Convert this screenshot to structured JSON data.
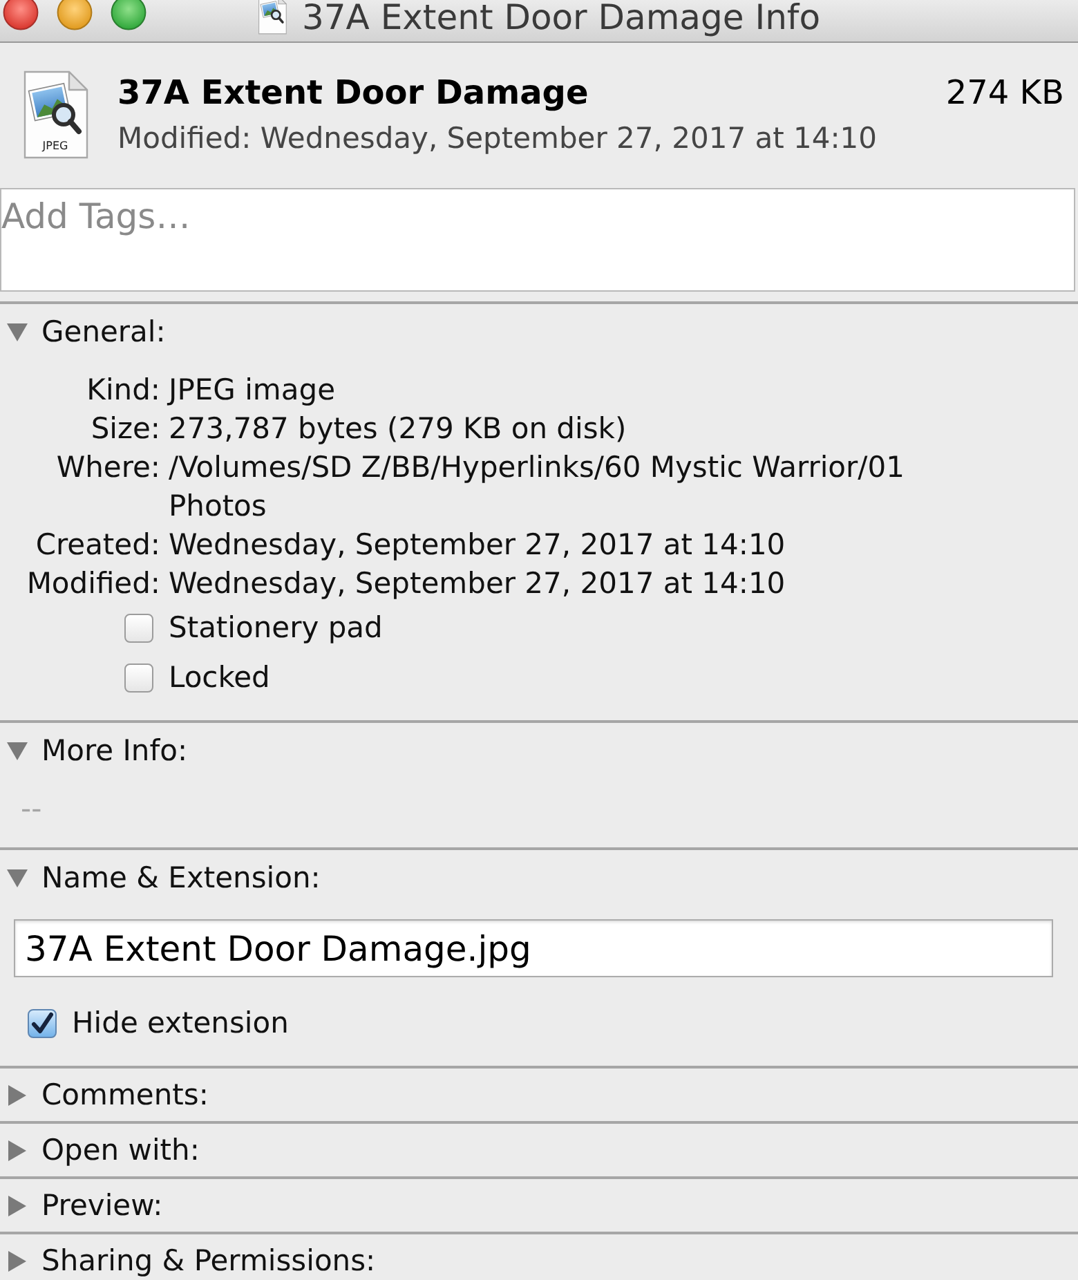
{
  "window": {
    "title": "37A Extent Door Damage Info"
  },
  "header": {
    "file_type": "JPEG",
    "name": "37A Extent Door Damage",
    "size": "274 KB",
    "modified": "Modified: Wednesday, September 27, 2017 at 14:10"
  },
  "tags": {
    "placeholder": "Add Tags…"
  },
  "sections": [
    {
      "kind": "general",
      "title": "General:",
      "expanded": true,
      "fields": [
        {
          "label": "Kind:",
          "value": "JPEG image"
        },
        {
          "label": "Size:",
          "value": "273,787 bytes (279 KB on disk)"
        },
        {
          "label": "Where:",
          "value": "/Volumes/SD Z/BB/Hyperlinks/60 Mystic Warrior/01 Photos"
        },
        {
          "label": "Created:",
          "value": "Wednesday, September 27, 2017 at 14:10"
        },
        {
          "label": "Modified:",
          "value": "Wednesday, September 27, 2017 at 14:10"
        }
      ],
      "checkboxes": [
        {
          "label": "Stationery pad",
          "checked": false
        },
        {
          "label": "Locked",
          "checked": false
        }
      ]
    },
    {
      "kind": "text",
      "title": "More Info:",
      "expanded": true,
      "text": "--"
    },
    {
      "kind": "name",
      "title": "Name & Extension:",
      "expanded": true,
      "value": "37A Extent Door Damage.jpg",
      "checkboxes": [
        {
          "label": "Hide extension",
          "checked": true
        }
      ]
    },
    {
      "title": "Comments:",
      "expanded": false
    },
    {
      "title": "Open with:",
      "expanded": false
    },
    {
      "title": "Preview:",
      "expanded": false
    },
    {
      "title": "Sharing & Permissions:",
      "expanded": false
    }
  ]
}
